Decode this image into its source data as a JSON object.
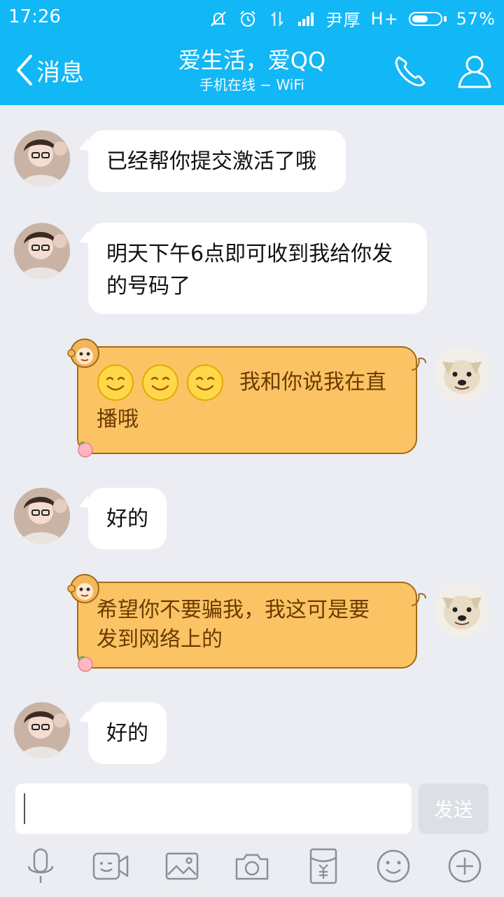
{
  "status_bar": {
    "time": "17:26",
    "carrier": "尹厚",
    "network": "H+",
    "battery": "57%",
    "battery_level": 0.57
  },
  "header": {
    "back_label": "消息",
    "title": "爱生活，爱QQ",
    "subtitle": "手机在线 − WiFi"
  },
  "messages": [
    {
      "side": "left",
      "text": "已经帮你提交激活了哦"
    },
    {
      "side": "left",
      "text_line1": "明天下午6点即可收到我给你发",
      "text_line2": "的号码了"
    },
    {
      "side": "right",
      "emoji": [
        "smile-emoji",
        "smile-emoji",
        "smile-emoji"
      ],
      "text_line1": "我和你说我在直",
      "text_line2": "播哦"
    },
    {
      "side": "left",
      "text": "好的"
    },
    {
      "side": "right",
      "text_line1": "希望你不要骗我，我这可是要",
      "text_line2": "发到网络上的"
    },
    {
      "side": "left",
      "text": "好的"
    }
  ],
  "input": {
    "value": "",
    "send_label": "发送"
  },
  "toolbar": [
    "microphone-icon",
    "video-chat-icon",
    "image-icon",
    "camera-icon",
    "red-packet-icon",
    "emoji-icon",
    "plus-icon"
  ],
  "colors": {
    "header_blue": "#12b7f5",
    "bubble_orange": "#fcc365",
    "bubble_text_brown": "#6a3b00",
    "background": "#ebedf2"
  }
}
